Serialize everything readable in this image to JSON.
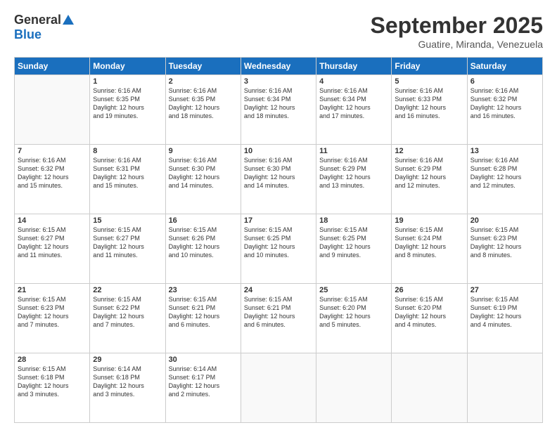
{
  "header": {
    "logo_general": "General",
    "logo_blue": "Blue",
    "month_title": "September 2025",
    "location": "Guatire, Miranda, Venezuela"
  },
  "days_of_week": [
    "Sunday",
    "Monday",
    "Tuesday",
    "Wednesday",
    "Thursday",
    "Friday",
    "Saturday"
  ],
  "weeks": [
    [
      {
        "day": "",
        "info": ""
      },
      {
        "day": "1",
        "info": "Sunrise: 6:16 AM\nSunset: 6:35 PM\nDaylight: 12 hours\nand 19 minutes."
      },
      {
        "day": "2",
        "info": "Sunrise: 6:16 AM\nSunset: 6:35 PM\nDaylight: 12 hours\nand 18 minutes."
      },
      {
        "day": "3",
        "info": "Sunrise: 6:16 AM\nSunset: 6:34 PM\nDaylight: 12 hours\nand 18 minutes."
      },
      {
        "day": "4",
        "info": "Sunrise: 6:16 AM\nSunset: 6:34 PM\nDaylight: 12 hours\nand 17 minutes."
      },
      {
        "day": "5",
        "info": "Sunrise: 6:16 AM\nSunset: 6:33 PM\nDaylight: 12 hours\nand 16 minutes."
      },
      {
        "day": "6",
        "info": "Sunrise: 6:16 AM\nSunset: 6:32 PM\nDaylight: 12 hours\nand 16 minutes."
      }
    ],
    [
      {
        "day": "7",
        "info": "Sunrise: 6:16 AM\nSunset: 6:32 PM\nDaylight: 12 hours\nand 15 minutes."
      },
      {
        "day": "8",
        "info": "Sunrise: 6:16 AM\nSunset: 6:31 PM\nDaylight: 12 hours\nand 15 minutes."
      },
      {
        "day": "9",
        "info": "Sunrise: 6:16 AM\nSunset: 6:30 PM\nDaylight: 12 hours\nand 14 minutes."
      },
      {
        "day": "10",
        "info": "Sunrise: 6:16 AM\nSunset: 6:30 PM\nDaylight: 12 hours\nand 14 minutes."
      },
      {
        "day": "11",
        "info": "Sunrise: 6:16 AM\nSunset: 6:29 PM\nDaylight: 12 hours\nand 13 minutes."
      },
      {
        "day": "12",
        "info": "Sunrise: 6:16 AM\nSunset: 6:29 PM\nDaylight: 12 hours\nand 12 minutes."
      },
      {
        "day": "13",
        "info": "Sunrise: 6:16 AM\nSunset: 6:28 PM\nDaylight: 12 hours\nand 12 minutes."
      }
    ],
    [
      {
        "day": "14",
        "info": "Sunrise: 6:15 AM\nSunset: 6:27 PM\nDaylight: 12 hours\nand 11 minutes."
      },
      {
        "day": "15",
        "info": "Sunrise: 6:15 AM\nSunset: 6:27 PM\nDaylight: 12 hours\nand 11 minutes."
      },
      {
        "day": "16",
        "info": "Sunrise: 6:15 AM\nSunset: 6:26 PM\nDaylight: 12 hours\nand 10 minutes."
      },
      {
        "day": "17",
        "info": "Sunrise: 6:15 AM\nSunset: 6:25 PM\nDaylight: 12 hours\nand 10 minutes."
      },
      {
        "day": "18",
        "info": "Sunrise: 6:15 AM\nSunset: 6:25 PM\nDaylight: 12 hours\nand 9 minutes."
      },
      {
        "day": "19",
        "info": "Sunrise: 6:15 AM\nSunset: 6:24 PM\nDaylight: 12 hours\nand 8 minutes."
      },
      {
        "day": "20",
        "info": "Sunrise: 6:15 AM\nSunset: 6:23 PM\nDaylight: 12 hours\nand 8 minutes."
      }
    ],
    [
      {
        "day": "21",
        "info": "Sunrise: 6:15 AM\nSunset: 6:23 PM\nDaylight: 12 hours\nand 7 minutes."
      },
      {
        "day": "22",
        "info": "Sunrise: 6:15 AM\nSunset: 6:22 PM\nDaylight: 12 hours\nand 7 minutes."
      },
      {
        "day": "23",
        "info": "Sunrise: 6:15 AM\nSunset: 6:21 PM\nDaylight: 12 hours\nand 6 minutes."
      },
      {
        "day": "24",
        "info": "Sunrise: 6:15 AM\nSunset: 6:21 PM\nDaylight: 12 hours\nand 6 minutes."
      },
      {
        "day": "25",
        "info": "Sunrise: 6:15 AM\nSunset: 6:20 PM\nDaylight: 12 hours\nand 5 minutes."
      },
      {
        "day": "26",
        "info": "Sunrise: 6:15 AM\nSunset: 6:20 PM\nDaylight: 12 hours\nand 4 minutes."
      },
      {
        "day": "27",
        "info": "Sunrise: 6:15 AM\nSunset: 6:19 PM\nDaylight: 12 hours\nand 4 minutes."
      }
    ],
    [
      {
        "day": "28",
        "info": "Sunrise: 6:15 AM\nSunset: 6:18 PM\nDaylight: 12 hours\nand 3 minutes."
      },
      {
        "day": "29",
        "info": "Sunrise: 6:14 AM\nSunset: 6:18 PM\nDaylight: 12 hours\nand 3 minutes."
      },
      {
        "day": "30",
        "info": "Sunrise: 6:14 AM\nSunset: 6:17 PM\nDaylight: 12 hours\nand 2 minutes."
      },
      {
        "day": "",
        "info": ""
      },
      {
        "day": "",
        "info": ""
      },
      {
        "day": "",
        "info": ""
      },
      {
        "day": "",
        "info": ""
      }
    ]
  ]
}
